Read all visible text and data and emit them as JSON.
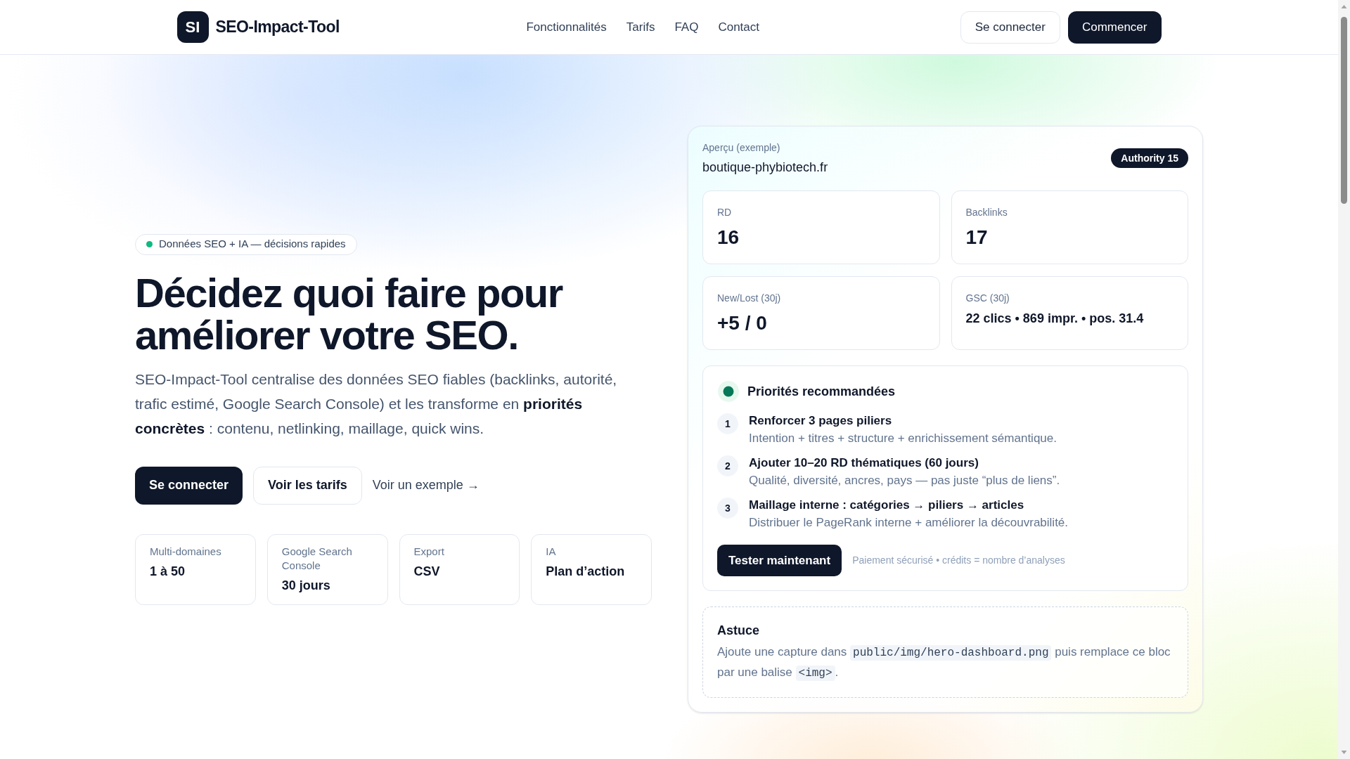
{
  "header": {
    "logo": {
      "mark": "SI",
      "name": "SEO-Impact-Tool"
    },
    "nav": [
      {
        "label": "Fonctionnalités"
      },
      {
        "label": "Tarifs"
      },
      {
        "label": "FAQ"
      },
      {
        "label": "Contact"
      }
    ],
    "actions": [
      {
        "label": "Se connecter",
        "kind": "outline"
      },
      {
        "label": "Commencer",
        "kind": "primary"
      }
    ]
  },
  "hero": {
    "tagline": "Données SEO + IA — décisions rapides",
    "headline": "Décidez quoi faire pour améliorer votre SEO.",
    "description": "SEO-Impact-Tool centralise des données SEO fiables (backlinks, autorité, trafic estimé, Google Search Console) et les transforme en **priorités concrètes** : contenu, netlinking, maillage, quick wins.",
    "buttons": [
      {
        "label": "Se connecter",
        "kind": "primary"
      },
      {
        "label": "Voir les tarifs",
        "kind": "outline"
      },
      {
        "label": "Voir un exemple →",
        "kind": "link"
      }
    ],
    "features": [
      {
        "label": "Multi-domaines",
        "value": "1 à 50"
      },
      {
        "label": "Google Search Console",
        "value": "30 jours"
      },
      {
        "label": "Export",
        "value": "CSV"
      },
      {
        "label": "IA",
        "value": "Plan d’action"
      }
    ]
  },
  "preview": {
    "eyebrow": "Aperçu (exemple)",
    "domain": "boutique-phybiotech.fr",
    "authority": "Authority 15",
    "metrics": [
      {
        "label": "RD",
        "value": "16",
        "kind": "big"
      },
      {
        "label": "Backlinks",
        "value": "17",
        "kind": "big"
      },
      {
        "label": "New/Lost (30j)",
        "value": "+5 / 0",
        "kind": "big"
      },
      {
        "label": "GSC (30j)",
        "value": "22 clics • 869 impr. • pos. 31.4",
        "kind": "small"
      }
    ],
    "priorities": {
      "title": "Priorités recommandées",
      "items": [
        {
          "number": "1",
          "title": "Renforcer 3 pages piliers",
          "detail": "Intention + titres + structure + enrichissement sémantique."
        },
        {
          "number": "2",
          "title": "Ajouter 10–20 RD thématiques (60 jours)",
          "detail": "Qualité, diversité, ancres, pays — pas juste “plus de liens”."
        },
        {
          "number": "3",
          "title": "Maillage interne : catégories → piliers → articles",
          "detail": "Distribuer le PageRank interne + améliorer la découvrabilité."
        }
      ],
      "button": "Tester maintenant",
      "note": "Paiement sécurisé • crédits = nombre d’analyses"
    },
    "tip": {
      "title": "Astuce",
      "text": [
        {
          "kind": "text",
          "value": "Ajoute une capture dans "
        },
        {
          "kind": "code",
          "value": "public/img/hero-dashboard.png"
        },
        {
          "kind": "text",
          "value": " puis remplace ce bloc par une balise "
        },
        {
          "kind": "code",
          "value": "<img>"
        },
        {
          "kind": "text",
          "value": "."
        }
      ]
    }
  }
}
